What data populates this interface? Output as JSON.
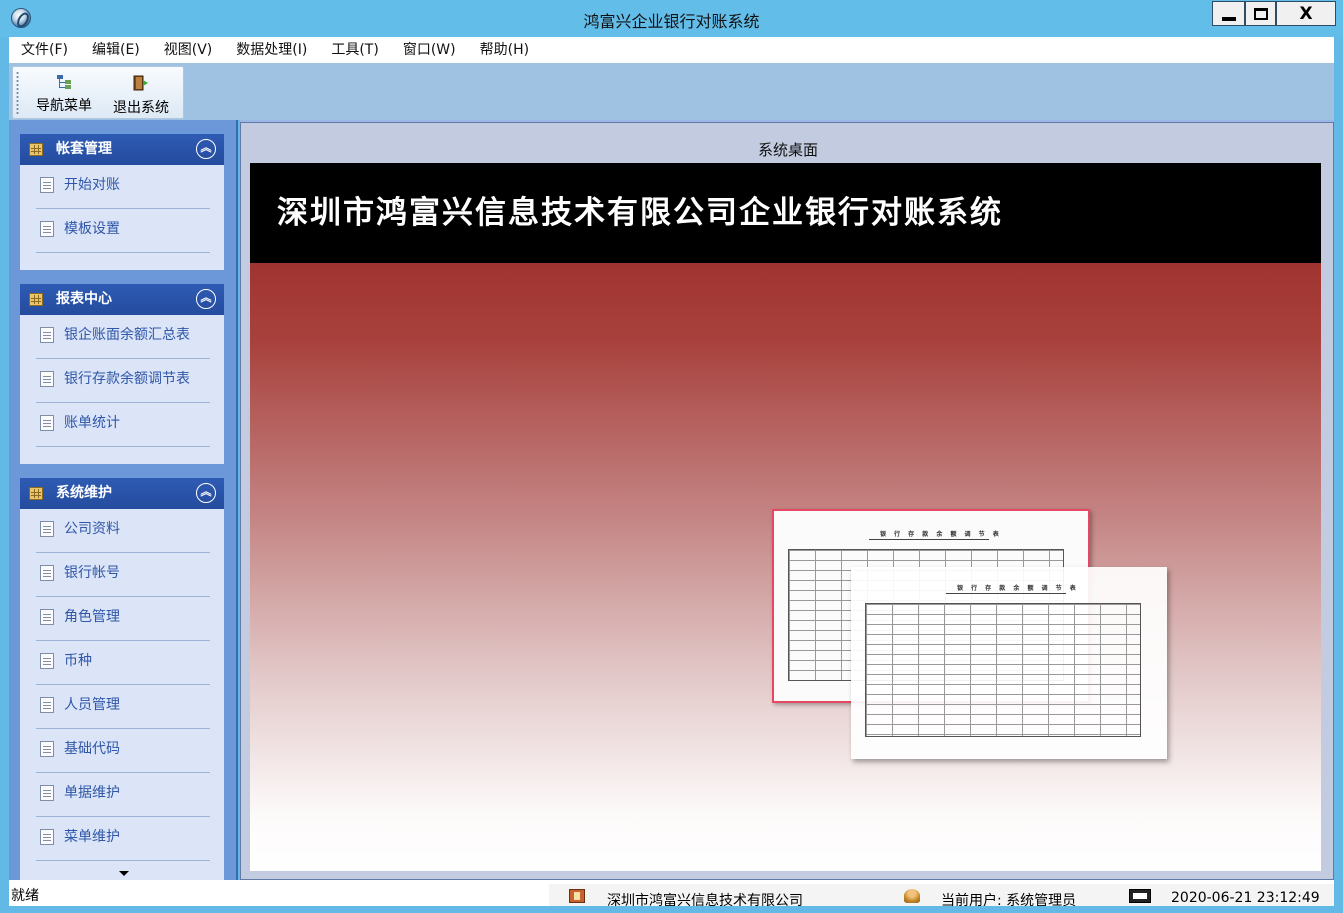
{
  "window": {
    "title": "鸿富兴企业银行对账系统",
    "controls": {
      "minimize": "minimize",
      "maximize": "maximize",
      "close": "X"
    }
  },
  "menu": {
    "items": [
      "文件(F)",
      "编辑(E)",
      "视图(V)",
      "数据处理(I)",
      "工具(T)",
      "窗口(W)",
      "帮助(H)"
    ]
  },
  "toolbar": {
    "nav_menu_label": "导航菜单",
    "exit_label": "退出系统"
  },
  "sidebar": {
    "groups": [
      {
        "title": "帐套管理",
        "items": [
          "开始对账",
          "模板设置"
        ]
      },
      {
        "title": "报表中心",
        "items": [
          "银企账面余额汇总表",
          "银行存款余额调节表",
          "账单统计"
        ]
      },
      {
        "title": "系统维护",
        "items": [
          "公司资料",
          "银行帐号",
          "角色管理",
          "币种",
          "人员管理",
          "基础代码",
          "单据维护",
          "菜单维护"
        ]
      }
    ],
    "accent_color": "#2f5bb4"
  },
  "desktop": {
    "title": "系统桌面",
    "banner_text": "深圳市鸿富兴信息技术有限公司企业银行对账系统",
    "paper1_title": "银 行 存 款 余 额 调 节 表",
    "paper2_title": "银 行 存 款 余 额 调 节 表"
  },
  "status": {
    "ready": "就绪",
    "company": "深圳市鸿富兴信息技术有限公司",
    "user": "当前用户: 系统管理员",
    "datetime": "2020-06-21 23:12:49"
  }
}
